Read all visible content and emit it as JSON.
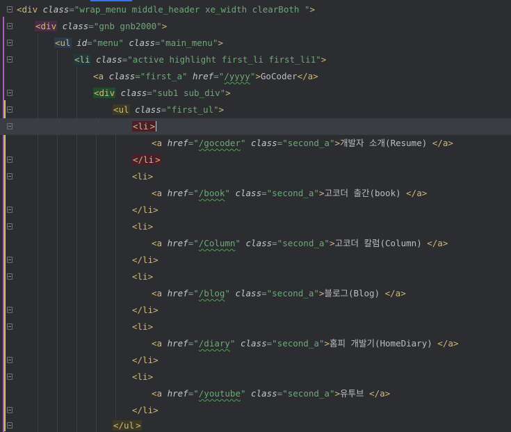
{
  "lines": [
    {
      "tokens": [
        "<div",
        "class",
        "=\"wrap_menu middle_header xe_width clearBoth \"",
        ">"
      ]
    },
    {
      "tokens": [
        "<div",
        "class",
        "=\"gnb gnb2000\"",
        ">"
      ]
    },
    {
      "tokens": [
        "<ul",
        "id",
        "=\"menu\"",
        "class",
        "=\"main_menu\"",
        ">"
      ]
    },
    {
      "tokens": [
        "<li",
        "class",
        "=\"active highlight first_li first_li1\"",
        ">"
      ]
    },
    {
      "tokens": [
        "<a",
        "class",
        "=\"first_a\"",
        "href",
        "=\"",
        "/yyyy",
        "\"",
        ">",
        "GoCoder",
        "</a",
        ">"
      ]
    },
    {
      "tokens": [
        "<div",
        "class",
        "=\"sub1 sub_div\"",
        ">"
      ]
    },
    {
      "tokens": [
        "<ul",
        "class",
        "=\"first_ul\"",
        ">"
      ]
    },
    {
      "tokens": [
        "<li",
        ">"
      ]
    },
    {
      "tokens": [
        "<a",
        "href",
        "=\"",
        "/gocoder",
        "\"",
        "class",
        "=\"second_a\"",
        ">",
        "개발자 소개(Resume) ",
        "</a",
        ">"
      ]
    },
    {
      "tokens": [
        "</li",
        ">"
      ]
    },
    {
      "tokens": [
        "<li",
        ">"
      ]
    },
    {
      "tokens": [
        "<a",
        "href",
        "=\"",
        "/book",
        "\"",
        "class",
        "=\"second_a\"",
        ">",
        "고코더 출간(book) ",
        "</a",
        ">"
      ]
    },
    {
      "tokens": [
        "</li",
        ">"
      ]
    },
    {
      "tokens": [
        "<li",
        ">"
      ]
    },
    {
      "tokens": [
        "<a",
        "href",
        "=\"",
        "/Column",
        "\"",
        "class",
        "=\"second_a\"",
        ">",
        "고코더 칼럼(Column) ",
        "</a",
        ">"
      ]
    },
    {
      "tokens": [
        "</li",
        ">"
      ]
    },
    {
      "tokens": [
        "<li",
        ">"
      ]
    },
    {
      "tokens": [
        "<a",
        "href",
        "=\"",
        "/blog",
        "\"",
        "class",
        "=\"second_a\"",
        ">",
        "블로그(Blog) ",
        "</a",
        ">"
      ]
    },
    {
      "tokens": [
        "</li",
        ">"
      ]
    },
    {
      "tokens": [
        "<li",
        ">"
      ]
    },
    {
      "tokens": [
        "<a",
        "href",
        "=\"",
        "/diary",
        "\"",
        "class",
        "=\"second_a\"",
        ">",
        "홈피 개발기(HomeDiary) ",
        "</a",
        ">"
      ]
    },
    {
      "tokens": [
        "</li",
        ">"
      ]
    },
    {
      "tokens": [
        "<li",
        ">"
      ]
    },
    {
      "tokens": [
        "<a",
        "href",
        "=\"",
        "/youtube",
        "\"",
        "class",
        "=\"second_a\"",
        ">",
        "유투브 ",
        "</a",
        ">"
      ]
    },
    {
      "tokens": [
        "</li",
        ">"
      ]
    },
    {
      "tokens": [
        "</ul",
        ">"
      ]
    }
  ],
  "colors": {
    "background": "#2b2d30",
    "current_line": "#3a3d44",
    "tag": "#d5b778",
    "attribute": "#bababa",
    "string": "#6aab73",
    "text": "#bcbec4"
  }
}
